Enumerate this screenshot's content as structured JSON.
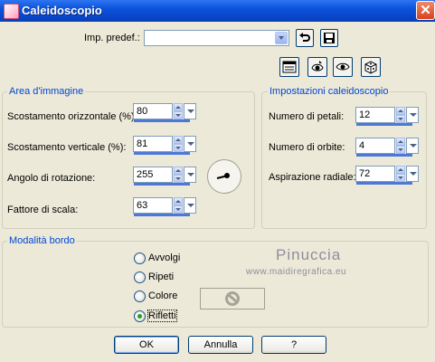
{
  "window": {
    "title": "Caleidoscopio",
    "close_glyph": "✕"
  },
  "preset": {
    "label": "Imp. predef.:",
    "value": ""
  },
  "toolbar_icons": [
    "undo-icon",
    "save-icon",
    "preview-icon",
    "zoom-in-icon",
    "eye-icon",
    "random-dice-icon"
  ],
  "area": {
    "title": "Area d'immagine",
    "fields": [
      {
        "label": "Scostamento orizzontale (%):",
        "value": "80"
      },
      {
        "label": "Scostamento verticale (%):",
        "value": "81"
      },
      {
        "label": "Angolo di rotazione:",
        "value": "255"
      },
      {
        "label": "Fattore di scala:",
        "value": "63"
      }
    ]
  },
  "settings": {
    "title": "Impostazioni caleidoscopio",
    "fields": [
      {
        "label": "Numero di petali:",
        "value": "12"
      },
      {
        "label": "Numero di orbite:",
        "value": "4"
      },
      {
        "label": "Aspirazione radiale:",
        "value": "72"
      }
    ]
  },
  "edge": {
    "title": "Modalità bordo",
    "options": [
      {
        "label": "Avvolgi",
        "checked": false
      },
      {
        "label": "Ripeti",
        "checked": false
      },
      {
        "label": "Colore",
        "checked": false
      },
      {
        "label": "Rifletti",
        "checked": true
      }
    ]
  },
  "watermark": {
    "name": "Pinuccia",
    "site": "www.maidiregrafica.eu"
  },
  "buttons": {
    "ok": "OK",
    "cancel": "Annulla",
    "help": "?"
  },
  "colors": {
    "accent": "#0046d5",
    "titlebar": "#0a52dc",
    "face": "#ece9d8"
  }
}
